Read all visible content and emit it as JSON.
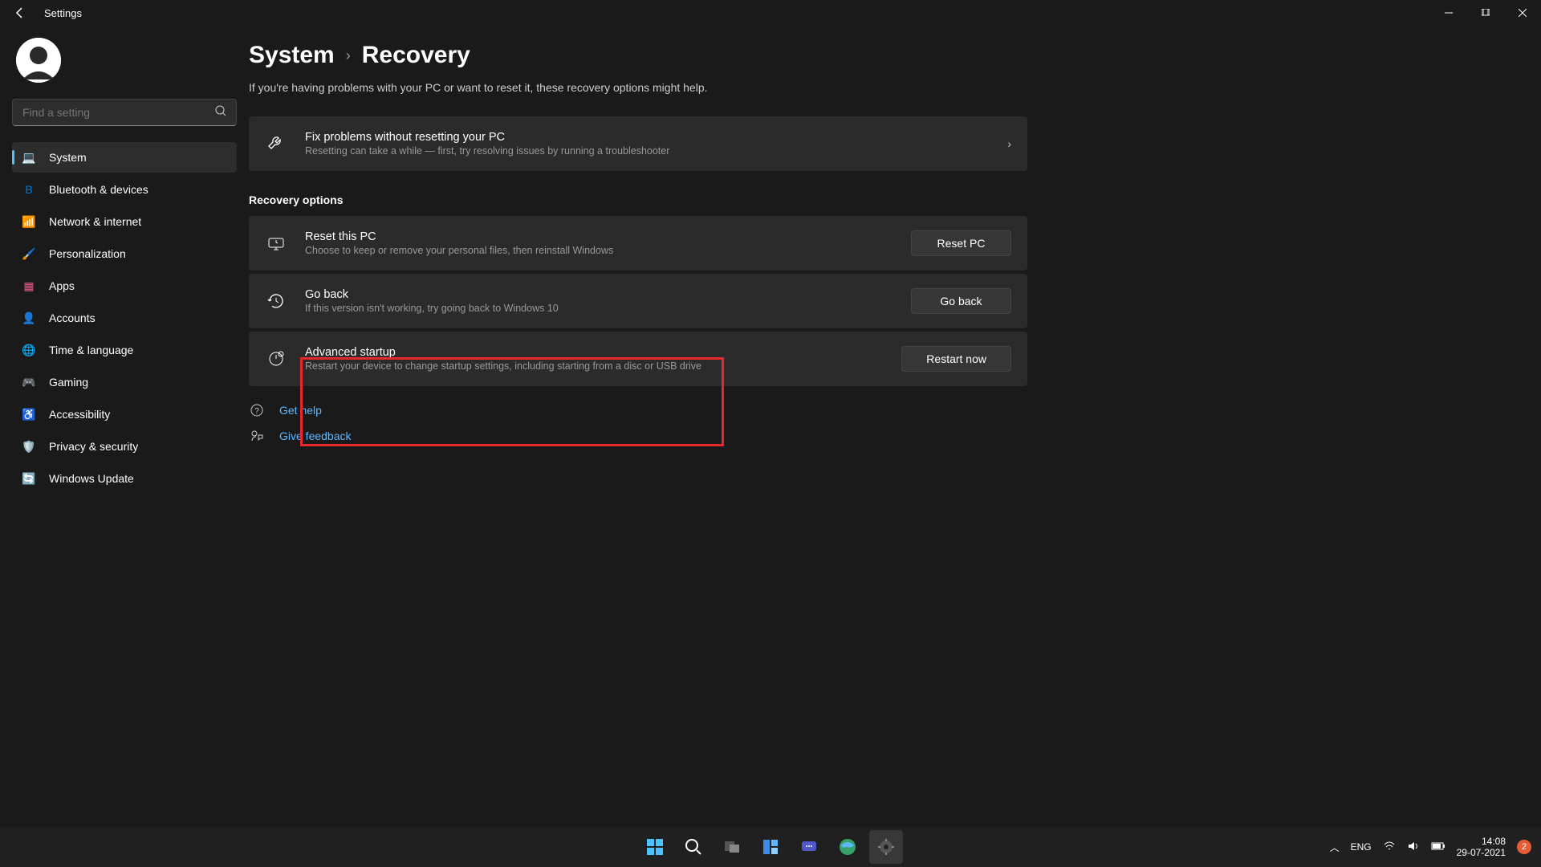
{
  "window": {
    "title": "Settings"
  },
  "search": {
    "placeholder": "Find a setting"
  },
  "nav": {
    "items": [
      {
        "label": "System",
        "icon": "💻",
        "color": "#4cc2ff",
        "active": true
      },
      {
        "label": "Bluetooth & devices",
        "icon": "B",
        "color": "#0078d4"
      },
      {
        "label": "Network & internet",
        "icon": "📶",
        "color": "#0078d4"
      },
      {
        "label": "Personalization",
        "icon": "🖌️",
        "color": "#e8912c"
      },
      {
        "label": "Apps",
        "icon": "▦",
        "color": "#e85b8f"
      },
      {
        "label": "Accounts",
        "icon": "👤",
        "color": "#ecac3f"
      },
      {
        "label": "Time & language",
        "icon": "🌐",
        "color": "#4cc2ff"
      },
      {
        "label": "Gaming",
        "icon": "🎮",
        "color": "#888"
      },
      {
        "label": "Accessibility",
        "icon": "♿",
        "color": "#0078d4"
      },
      {
        "label": "Privacy & security",
        "icon": "🛡️",
        "color": "#888"
      },
      {
        "label": "Windows Update",
        "icon": "🔄",
        "color": "#0078d4"
      }
    ]
  },
  "breadcrumb": {
    "parent": "System",
    "current": "Recovery"
  },
  "intro": "If you're having problems with your PC or want to reset it, these recovery options might help.",
  "fixcard": {
    "title": "Fix problems without resetting your PC",
    "sub": "Resetting can take a while — first, try resolving issues by running a troubleshooter"
  },
  "section_heading": "Recovery options",
  "reset": {
    "title": "Reset this PC",
    "sub": "Choose to keep or remove your personal files, then reinstall Windows",
    "btn": "Reset PC"
  },
  "goback": {
    "title": "Go back",
    "sub": "If this version isn't working, try going back to Windows 10",
    "btn": "Go back"
  },
  "advanced": {
    "title": "Advanced startup",
    "sub": "Restart your device to change startup settings, including starting from a disc or USB drive",
    "btn": "Restart now"
  },
  "links": {
    "help": "Get help",
    "feedback": "Give feedback"
  },
  "tray": {
    "lang": "ENG",
    "time": "14:08",
    "date": "29-07-2021",
    "notif": "2"
  }
}
